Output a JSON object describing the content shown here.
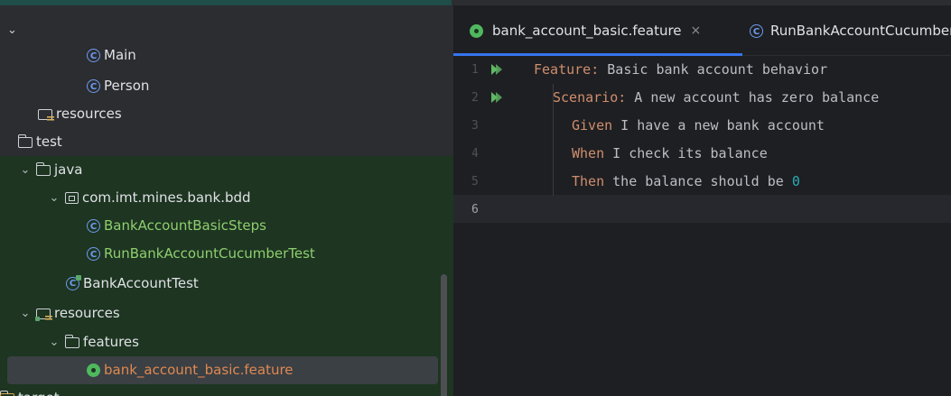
{
  "project_tree": {
    "items": [
      {
        "label": "Main"
      },
      {
        "label": "Person"
      },
      {
        "label": "resources"
      },
      {
        "label": "test"
      },
      {
        "label": "java"
      },
      {
        "label": "com.imt.mines.bank.bdd"
      },
      {
        "label": "BankAccountBasicSteps"
      },
      {
        "label": "RunBankAccountCucumberTest"
      },
      {
        "label": "BankAccountTest"
      },
      {
        "label": "resources"
      },
      {
        "label": "features"
      },
      {
        "label": "bank_account_basic.feature"
      },
      {
        "label": "target"
      }
    ]
  },
  "tabs": [
    {
      "label": "bank_account_basic.feature",
      "close": "×"
    },
    {
      "label": "RunBankAccountCucumberTest"
    }
  ],
  "editor": {
    "current_line": 6,
    "lines": [
      {
        "num": "1",
        "kw": "Feature:",
        "rest": " Basic bank account behavior"
      },
      {
        "num": "2",
        "kw": "Scenario:",
        "rest": " A new account has zero balance"
      },
      {
        "num": "3",
        "kw": "Given",
        "rest": " I have a new bank account"
      },
      {
        "num": "4",
        "kw": "When",
        "rest": " I check its balance"
      },
      {
        "num": "5",
        "kw": "Then",
        "rest": " the balance should be ",
        "value": "0"
      },
      {
        "num": "6"
      }
    ]
  },
  "colors": {
    "test_folder_bg": "#1d3521",
    "keyword": "#cf8e6d",
    "number": "#2aacb8",
    "accent_tab": "#3574f0"
  }
}
